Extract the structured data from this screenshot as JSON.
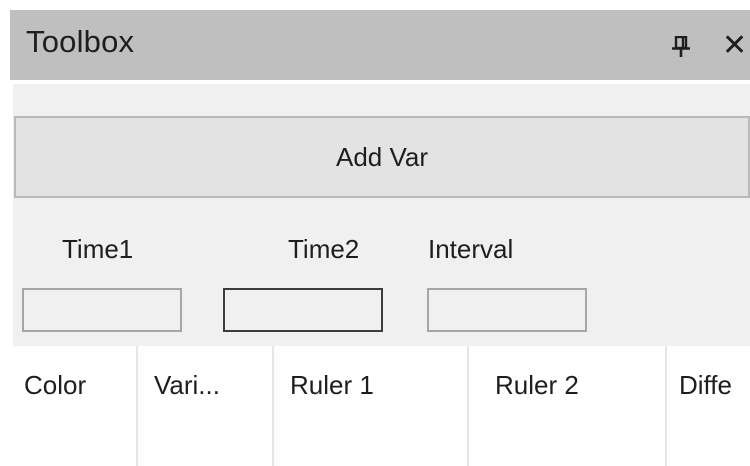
{
  "window": {
    "title": "Toolbox"
  },
  "icons": {
    "pin": "pin-icon",
    "close": "close-icon",
    "close_glyph": "✕"
  },
  "toolbar": {
    "add_var_label": "Add Var"
  },
  "fields": {
    "time1_label": "Time1",
    "time2_label": "Time2",
    "interval_label": "Interval",
    "time1_value": "",
    "time2_value": "",
    "interval_value": ""
  },
  "table": {
    "columns": [
      "Color",
      "Vari...",
      "Ruler 1",
      "Ruler 2",
      "Diffe"
    ]
  }
}
